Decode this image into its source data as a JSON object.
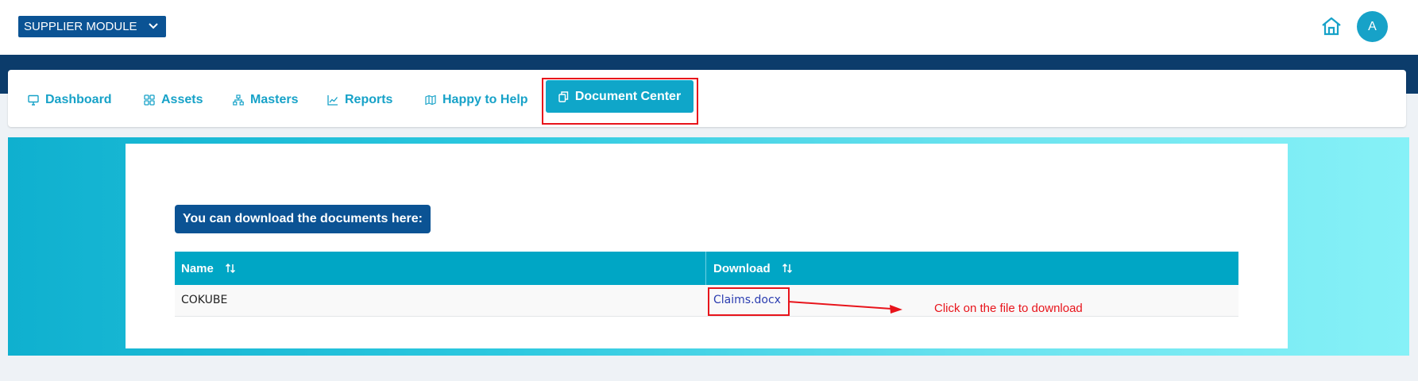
{
  "header": {
    "module_label": "SUPPLIER MODULE",
    "avatar_initial": "A"
  },
  "nav": {
    "items": [
      {
        "label": "Dashboard",
        "icon": "monitor-icon"
      },
      {
        "label": "Assets",
        "icon": "grid-icon"
      },
      {
        "label": "Masters",
        "icon": "hierarchy-icon"
      },
      {
        "label": "Reports",
        "icon": "trend-chart-icon"
      },
      {
        "label": "Happy to Help",
        "icon": "map-icon"
      },
      {
        "label": "Document Center",
        "icon": "documents-icon",
        "active": true
      }
    ]
  },
  "main": {
    "heading": "You can download the documents here:",
    "table": {
      "columns": [
        "Name",
        "Download"
      ],
      "rows": [
        {
          "name": "COKUBE",
          "download": "Claims.docx"
        }
      ]
    },
    "annotation": "Click on the file to download"
  },
  "colors": {
    "brand_navy": "#0b5394",
    "accent_teal": "#17a2c8",
    "annotation_red": "#e8141b"
  }
}
